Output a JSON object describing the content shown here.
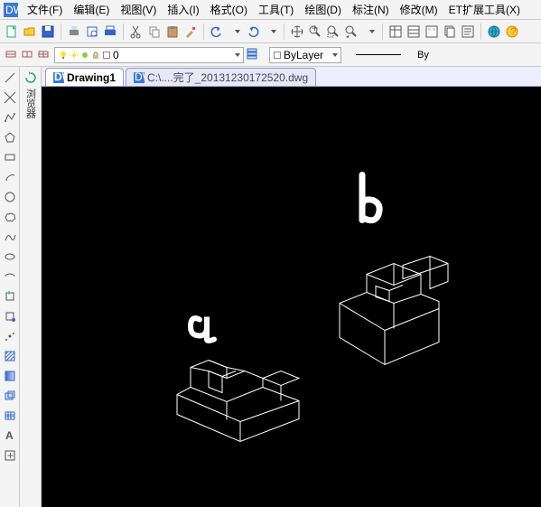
{
  "app": {
    "logo": "dwg"
  },
  "menu": {
    "file": "文件(F)",
    "edit": "编辑(E)",
    "view": "视图(V)",
    "insert": "插入(I)",
    "format": "格式(O)",
    "tools": "工具(T)",
    "draw": "绘图(D)",
    "dim": "标注(N)",
    "modify": "修改(M)",
    "ext": "ET扩展工具(X)"
  },
  "toolbar": {
    "new": "new",
    "open": "open",
    "save": "save",
    "print": "print",
    "preview": "preview",
    "plot": "plot",
    "cut": "cut",
    "copy": "copy",
    "paste": "paste",
    "match": "match",
    "undo": "undo",
    "redo": "redo",
    "pan": "pan",
    "zoomin": "zoomin",
    "zoomout": "zoomout",
    "zoomext": "zoomext",
    "props": "props",
    "table1": "t1",
    "table2": "t2",
    "table3": "t3",
    "table4": "t4",
    "globe": "globe",
    "help": "help"
  },
  "toolbar2": {
    "iso1": "iso1",
    "iso2": "iso2",
    "iso3": "iso3",
    "bulb": "bulb",
    "freeze": "freeze",
    "sun": "sun",
    "lock": "lock",
    "layer_current": "0",
    "linetype_current": "ByLayer",
    "right_label": "By"
  },
  "left_tools": {
    "line": "line",
    "xline": "xline",
    "pline": "pline",
    "polygon": "polygon",
    "rect": "rect",
    "arc": "arc",
    "circle": "circle",
    "revcloud": "revcloud",
    "spline": "spline",
    "ellipse": "ellipse",
    "ellipsearc": "ellipsearc",
    "insert": "insert",
    "block": "block",
    "point": "point",
    "hatch": "hatch",
    "gradient": "gradient",
    "region": "region",
    "table": "table",
    "mtext": "mtext",
    "addsel": "addsel"
  },
  "left_tools2": {
    "vert_label": "浏览器"
  },
  "tabs": {
    "t1": {
      "label": "Drawing1",
      "active": true
    },
    "t2": {
      "label": "C:\\....完了_20131230172520.dwg",
      "active": false
    }
  },
  "canvas": {
    "annot_a": "a",
    "annot_b": "b"
  }
}
